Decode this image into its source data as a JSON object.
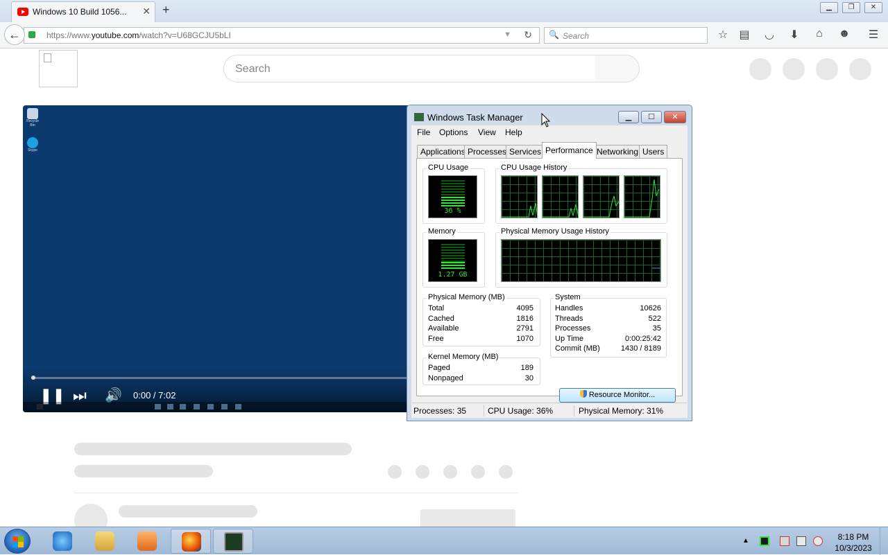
{
  "browser": {
    "tab_title": "Windows 10 Build 1056...",
    "url_prefix": "https://www.",
    "url_domain": "youtube.com",
    "url_path": "/watch?v=U68GCJU5bLI",
    "search_placeholder": "Search"
  },
  "youtube": {
    "search_placeholder": "Search"
  },
  "video": {
    "time": "0:00 / 7:02",
    "progress": 0.0
  },
  "task_manager": {
    "title": "Windows Task Manager",
    "menu": [
      "File",
      "Options",
      "View",
      "Help"
    ],
    "tabs": [
      "Applications",
      "Processes",
      "Services",
      "Performance",
      "Networking",
      "Users"
    ],
    "active_tab": "Performance",
    "cpu_usage_label": "CPU Usage",
    "cpu_usage_value": "36 %",
    "cpu_usage_fraction": 0.36,
    "cpu_history_label": "CPU Usage History",
    "memory_label": "Memory",
    "memory_value": "1.27 GB",
    "memory_fraction": 0.31,
    "memory_history_label": "Physical Memory Usage History",
    "physical_memory": {
      "label": "Physical Memory (MB)",
      "rows": [
        {
          "key": "Total",
          "value": "4095"
        },
        {
          "key": "Cached",
          "value": "1816"
        },
        {
          "key": "Available",
          "value": "2791"
        },
        {
          "key": "Free",
          "value": "1070"
        }
      ]
    },
    "kernel_memory": {
      "label": "Kernel Memory (MB)",
      "rows": [
        {
          "key": "Paged",
          "value": "189"
        },
        {
          "key": "Nonpaged",
          "value": "30"
        }
      ]
    },
    "system": {
      "label": "System",
      "rows": [
        {
          "key": "Handles",
          "value": "10626"
        },
        {
          "key": "Threads",
          "value": "522"
        },
        {
          "key": "Processes",
          "value": "35"
        },
        {
          "key": "Up Time",
          "value": "0:00:25:42"
        },
        {
          "key": "Commit (MB)",
          "value": "1430 / 8189"
        }
      ]
    },
    "resource_monitor_button": "Resource Monitor...",
    "status": {
      "processes": "Processes: 35",
      "cpu": "CPU Usage: 36%",
      "memory": "Physical Memory: 31%"
    }
  },
  "taskbar": {
    "time": "8:18 PM",
    "date": "10/3/2023",
    "apps": [
      "internet-explorer-icon",
      "file-explorer-icon",
      "media-player-icon",
      "firefox-icon",
      "task-manager-icon"
    ]
  },
  "colors": {
    "graph_green": "#2eea2e",
    "youtube_red": "#ff0000",
    "video_bg": "#0b3a6e"
  }
}
